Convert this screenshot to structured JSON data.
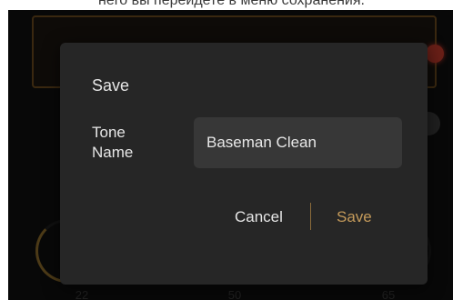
{
  "caption": {
    "text": "него вы перейдете в меню сохранения."
  },
  "background": {
    "knob_values": [
      "22",
      "50",
      "65"
    ]
  },
  "dialog": {
    "title": "Save",
    "tone_name_label": "Tone Name",
    "tone_name_value": "Baseman Clean",
    "cancel_label": "Cancel",
    "save_label": "Save"
  },
  "colors": {
    "accent": "#c49a5a",
    "dialog_bg": "#262626",
    "input_bg": "#373737",
    "amp_led": "#c0392b"
  }
}
